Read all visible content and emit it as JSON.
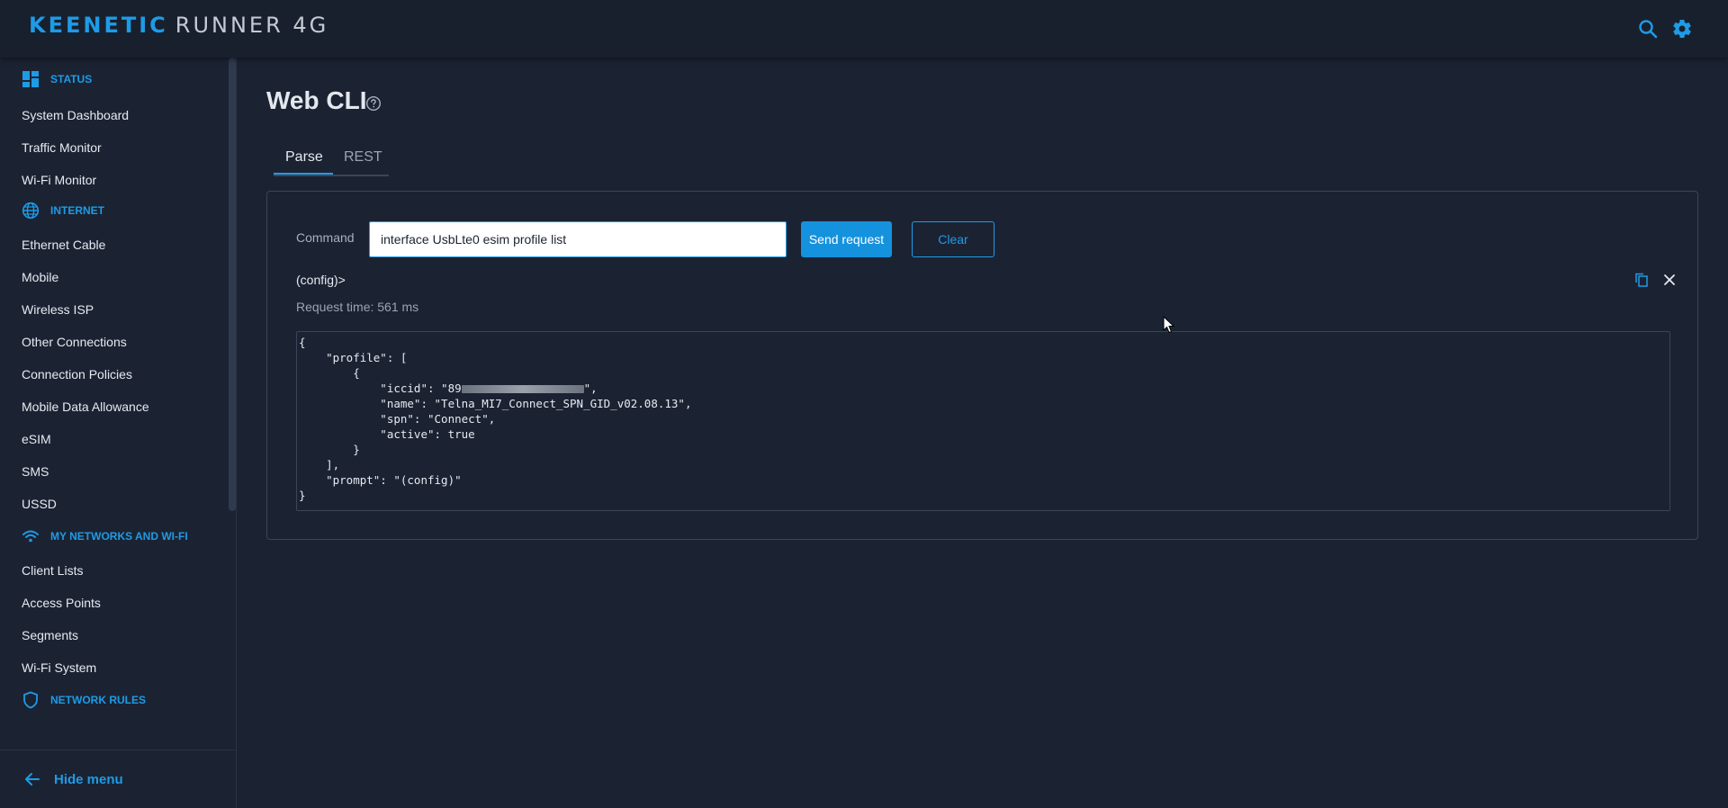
{
  "header": {
    "brand": "KEENETIC",
    "model": "RUNNER 4G",
    "search_icon": "search-icon",
    "settings_icon": "gear-icon",
    "accent": "#1e9be6"
  },
  "sidebar": {
    "sections": [
      {
        "title": "STATUS",
        "icon": "dashboard-icon",
        "items": [
          "System Dashboard",
          "Traffic Monitor",
          "Wi-Fi Monitor"
        ]
      },
      {
        "title": "INTERNET",
        "icon": "globe-icon",
        "items": [
          "Ethernet Cable",
          "Mobile",
          "Wireless ISP",
          "Other Connections",
          "Connection Policies",
          "Mobile Data Allowance",
          "eSIM",
          "SMS",
          "USSD"
        ]
      },
      {
        "title": "MY NETWORKS AND WI-FI",
        "icon": "wifi-icon",
        "items": [
          "Client Lists",
          "Access Points",
          "Segments",
          "Wi-Fi System"
        ]
      },
      {
        "title": "NETWORK RULES",
        "icon": "shield-icon",
        "items": []
      }
    ],
    "hide_menu": "Hide menu"
  },
  "page": {
    "title": "Web CLI",
    "tabs": [
      {
        "label": "Parse",
        "active": true
      },
      {
        "label": "REST",
        "active": false
      }
    ]
  },
  "form": {
    "command_label": "Command",
    "command_value": "interface UsbLte0 esim profile list",
    "send_label": "Send request",
    "clear_label": "Clear"
  },
  "result": {
    "prompt": "(config)>",
    "request_time": "Request time: 561 ms",
    "json_lines": [
      "{",
      "    \"profile\": [",
      "        {",
      "            \"iccid\": \"89",
      "            \"name\": \"Telna_MI7_Connect_SPN_GID_v02.08.13\",",
      "            \"spn\": \"Connect\",",
      "            \"active\": true",
      "        }",
      "    ],",
      "    \"prompt\": \"(config)\"",
      "}"
    ],
    "iccid_suffix": "\","
  }
}
